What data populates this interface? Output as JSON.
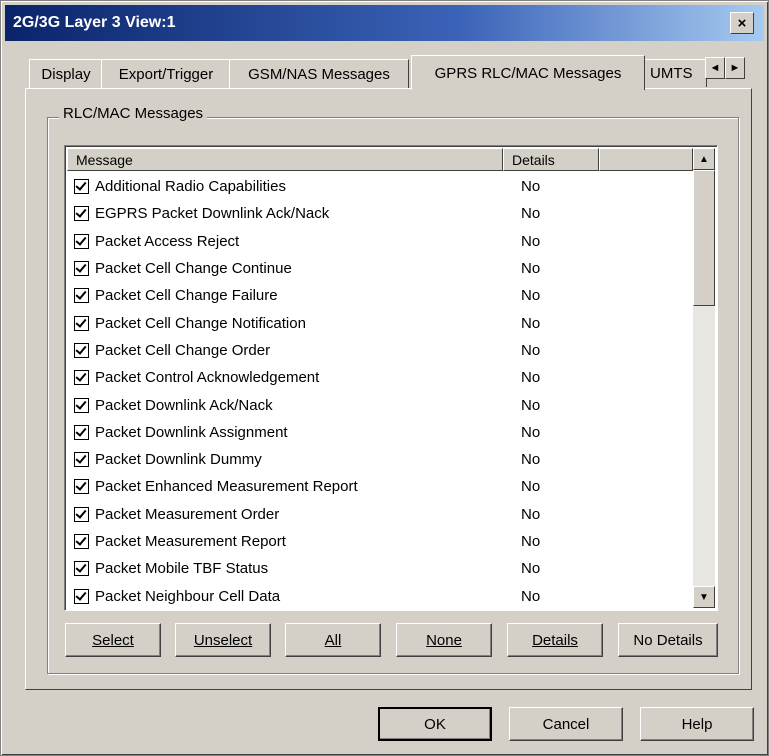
{
  "window": {
    "title": "2G/3G Layer 3 View:1",
    "close_label": "×"
  },
  "tabs": [
    {
      "label": "Display"
    },
    {
      "label": "Export/Trigger"
    },
    {
      "label": "GSM/NAS Messages"
    },
    {
      "label": "GPRS RLC/MAC Messages",
      "active": true
    },
    {
      "label": "UMTS"
    }
  ],
  "tab_scroll": {
    "left": "◄",
    "right": "►"
  },
  "group": {
    "label": "RLC/MAC Messages"
  },
  "list": {
    "columns": [
      "Message",
      "Details",
      ""
    ],
    "rows": [
      {
        "message": "Additional Radio Capabilities",
        "details": "No",
        "checked": true
      },
      {
        "message": "EGPRS Packet Downlink Ack/Nack",
        "details": "No",
        "checked": true
      },
      {
        "message": "Packet Access Reject",
        "details": "No",
        "checked": true
      },
      {
        "message": "Packet Cell Change Continue",
        "details": "No",
        "checked": true
      },
      {
        "message": "Packet Cell Change Failure",
        "details": "No",
        "checked": true
      },
      {
        "message": "Packet Cell Change Notification",
        "details": "No",
        "checked": true
      },
      {
        "message": "Packet Cell Change Order",
        "details": "No",
        "checked": true
      },
      {
        "message": "Packet Control Acknowledgement",
        "details": "No",
        "checked": true
      },
      {
        "message": "Packet Downlink Ack/Nack",
        "details": "No",
        "checked": true
      },
      {
        "message": "Packet Downlink Assignment",
        "details": "No",
        "checked": true
      },
      {
        "message": "Packet Downlink Dummy",
        "details": "No",
        "checked": true
      },
      {
        "message": "Packet Enhanced Measurement Report",
        "details": "No",
        "checked": true
      },
      {
        "message": "Packet Measurement Order",
        "details": "No",
        "checked": true
      },
      {
        "message": "Packet Measurement Report",
        "details": "No",
        "checked": true
      },
      {
        "message": "Packet Mobile TBF Status",
        "details": "No",
        "checked": true
      },
      {
        "message": "Packet Neighbour Cell Data",
        "details": "No",
        "checked": true
      }
    ]
  },
  "scroll": {
    "up": "▲",
    "down": "▼"
  },
  "list_buttons": {
    "select": "Select",
    "unselect": "Unselect",
    "all": "All",
    "none": "None",
    "details": "Details",
    "no_details": "No Details"
  },
  "dialog_buttons": {
    "ok": "OK",
    "cancel": "Cancel",
    "help": "Help"
  }
}
